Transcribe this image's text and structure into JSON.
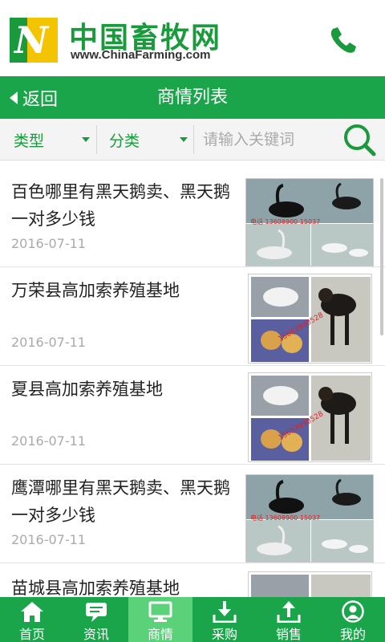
{
  "header": {
    "logo_cn": "中国畜牧网",
    "logo_en": "www.ChinaFarming.com",
    "phone_icon": "phone-icon"
  },
  "nav": {
    "back_label": "返回",
    "title": "商情列表"
  },
  "filters": {
    "type_label": "类型",
    "category_label": "分类",
    "search_placeholder": "请输入关键词"
  },
  "items": [
    {
      "title": "百色哪里有黑天鹅卖、黑天鹅一对多少钱",
      "date": "2016-07-11",
      "image": "black-swan-photo"
    },
    {
      "title": "万荣县高加索养殖基地",
      "date": "2016-07-11",
      "image": "caucasian-dog-photo"
    },
    {
      "title": "夏县高加索养殖基地",
      "date": "2016-07-11",
      "image": "caucasian-dog-photo"
    },
    {
      "title": "鹰潭哪里有黑天鹅卖、黑天鹅一对多少钱",
      "date": "2016-07-11",
      "image": "black-swan-photo"
    },
    {
      "title": "苗城县高加索养殖基地",
      "date": "",
      "image": "caucasian-dog-photo"
    }
  ],
  "tabs": [
    {
      "label": "首页",
      "icon": "home-icon"
    },
    {
      "label": "资讯",
      "icon": "chat-icon"
    },
    {
      "label": "商情",
      "icon": "monitor-icon",
      "active": true
    },
    {
      "label": "采购",
      "icon": "download-icon"
    },
    {
      "label": "销售",
      "icon": "upload-icon"
    },
    {
      "label": "我的",
      "icon": "user-icon"
    }
  ],
  "colors": {
    "brand_green": "#1aa54a",
    "active_tab": "#5bd17a",
    "logo_yellow": "#f2c500"
  }
}
